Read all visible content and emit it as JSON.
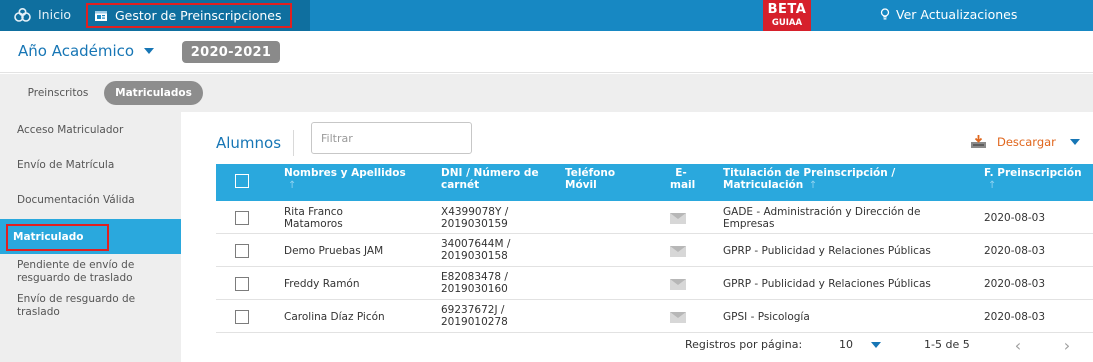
{
  "topbar": {
    "home_label": "Inicio",
    "app_label": "Gestor de Preinscripciones",
    "beta_label": "BETA",
    "beta_sub": "GUIAA",
    "updates_label": "Ver Actualizaciones",
    "colors": {
      "bar": "#1788c3",
      "bar_dark": "#0f6f9f",
      "beta": "#d6202b",
      "highlight_box": "#e02020"
    }
  },
  "year": {
    "label": "Año Académico",
    "value": "2020-2021"
  },
  "tabs": [
    {
      "label": "Preinscritos",
      "active": false
    },
    {
      "label": "Matriculados",
      "active": true
    }
  ],
  "sidebar": {
    "items": [
      {
        "label": "Acceso Matriculador",
        "active": false
      },
      {
        "label": "Envío de Matrícula",
        "active": false
      },
      {
        "label": "Documentación Válida",
        "active": false
      },
      {
        "label": "Matriculado",
        "active": true
      },
      {
        "label": "Pendiente de envío de resguardo de traslado",
        "active": false
      },
      {
        "label": "Envío de resguardo de traslado",
        "active": false
      }
    ]
  },
  "main": {
    "section_title": "Alumnos",
    "filter_placeholder": "Filtrar",
    "download_label": "Descargar",
    "columns": [
      {
        "label": "Nombres y Apellidos",
        "sort_icon": "↑"
      },
      {
        "label": "DNI / Número de carnét"
      },
      {
        "label": "Teléfono Móvil"
      },
      {
        "label": "E-mail"
      },
      {
        "label": "Titulación de Preinscripción / Matriculación",
        "sort_icon": "↑"
      },
      {
        "label": "F. Preinscripción",
        "sort_icon": "↑"
      }
    ],
    "rows": [
      {
        "name": "Rita Franco Matamoros",
        "dni": "X4399078Y / 2019030159",
        "phone": "",
        "email_icon": "envelope-icon",
        "degree": "GADE - Administración y Dirección de Empresas",
        "date": "2020-08-03"
      },
      {
        "name": "Demo Pruebas JAM",
        "dni": "34007644M / 2019030158",
        "phone": "",
        "email_icon": "envelope-icon",
        "degree": "GPRP - Publicidad y Relaciones Públicas",
        "date": "2020-08-03"
      },
      {
        "name": "Freddy Ramón",
        "dni": "E82083478 / 2019030160",
        "phone": "",
        "email_icon": "envelope-icon",
        "degree": "GPRP - Publicidad y Relaciones Públicas",
        "date": "2020-08-03"
      },
      {
        "name": "Carolina Díaz Picón",
        "dni": "69237672J / 2019010278",
        "phone": "",
        "email_icon": "envelope-icon",
        "degree": "GPSI - Psicología",
        "date": "2020-08-03"
      }
    ],
    "footer": {
      "per_page_label": "Registros por página:",
      "per_page_value": "10",
      "range_label": "1-5 de 5",
      "prev_icon": "‹",
      "next_icon": "›"
    }
  }
}
